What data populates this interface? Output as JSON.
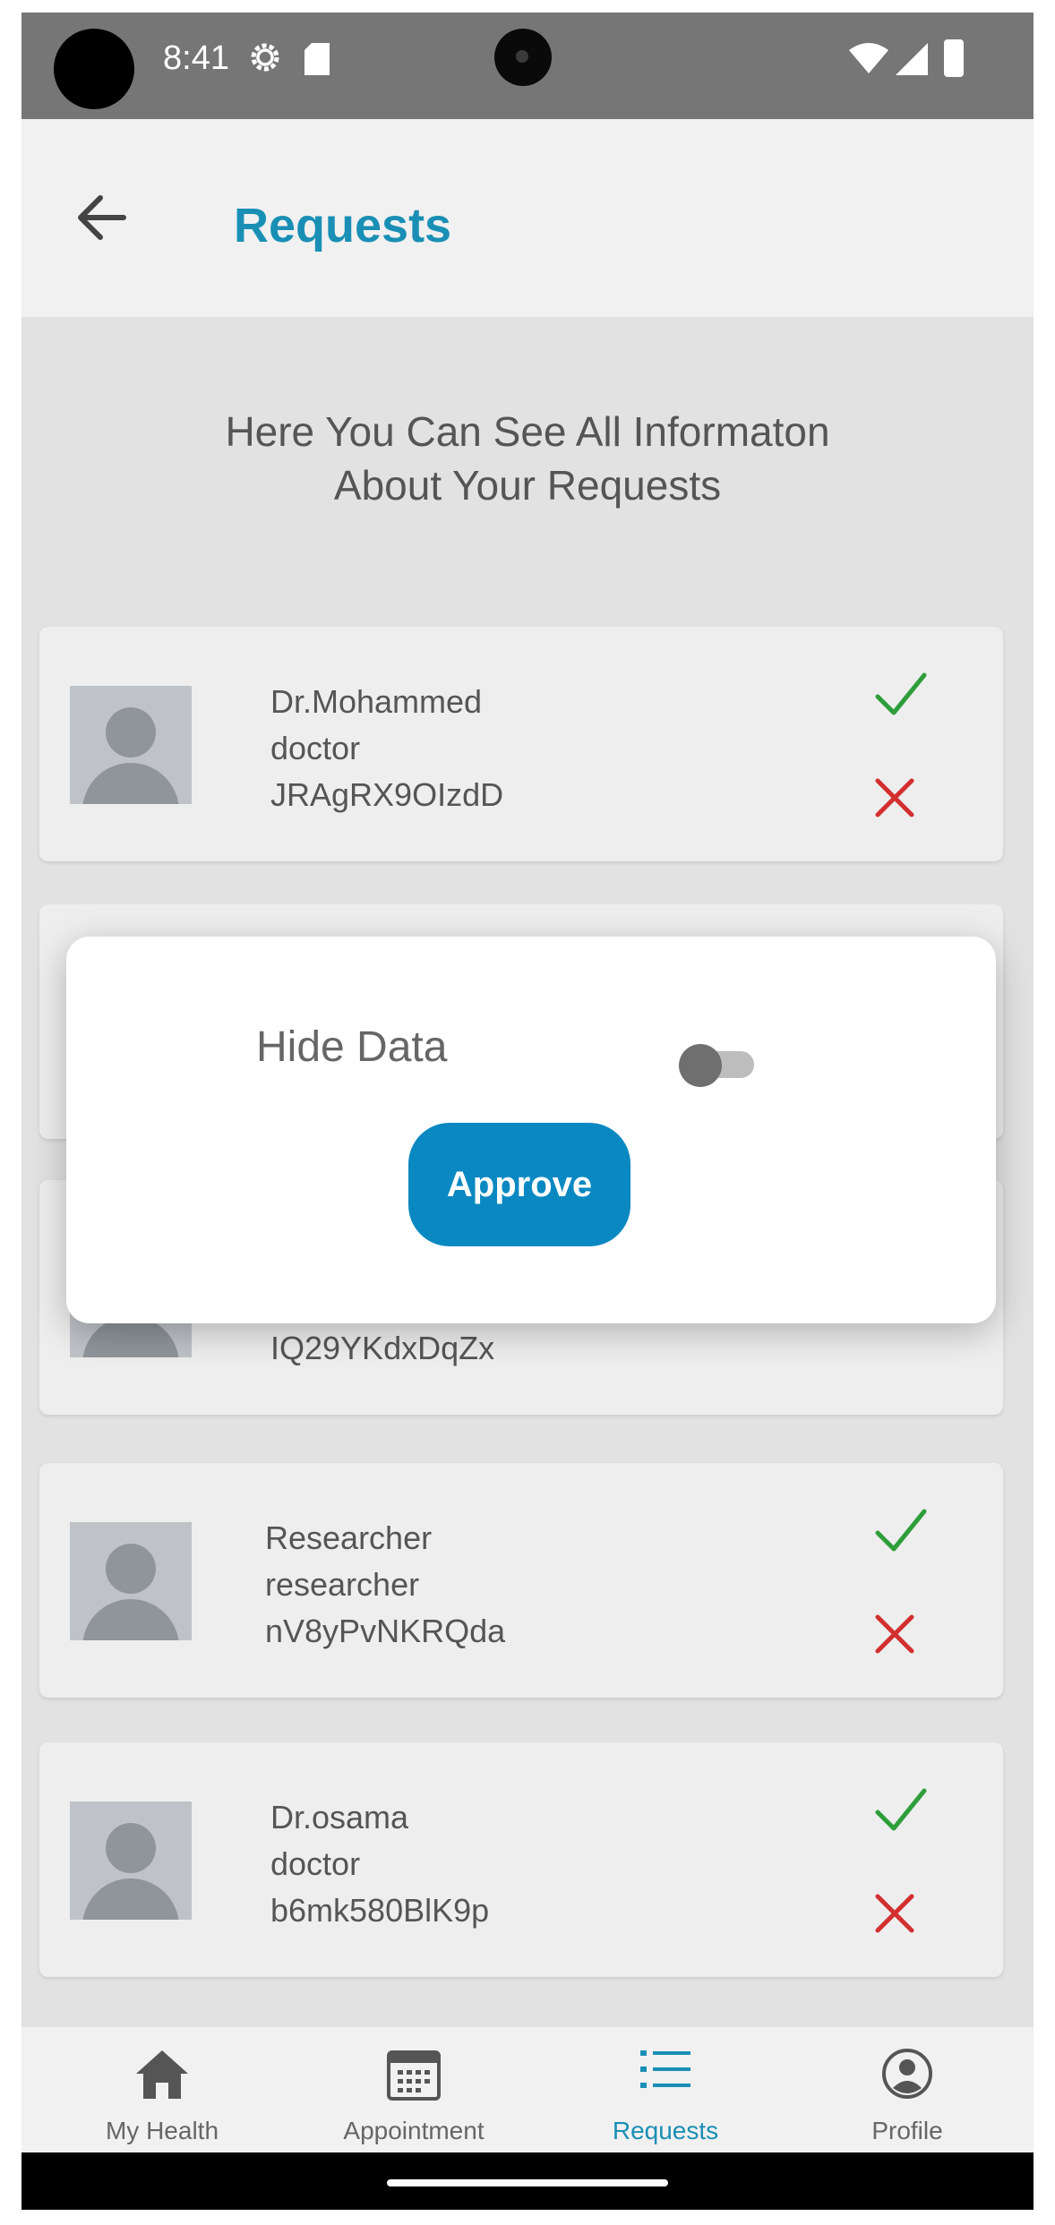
{
  "status_bar": {
    "time": "8:41"
  },
  "app_bar": {
    "title": "Requests"
  },
  "subtitle": {
    "line1": "Here You Can See All Informaton",
    "line2": "About Your Requests"
  },
  "requests": [
    {
      "name": "Dr.Mohammed",
      "role": "doctor",
      "id": "JRAgRX9OIzdD"
    },
    {
      "name": "",
      "role": "",
      "id": ""
    },
    {
      "name": "",
      "role": "",
      "id": "IQ29YKdxDqZx"
    },
    {
      "name": "Researcher",
      "role": "researcher",
      "id": "nV8yPvNKRQda"
    },
    {
      "name": "Dr.osama",
      "role": "doctor",
      "id": "b6mk580BlK9p"
    }
  ],
  "dialog": {
    "hide_label": "Hide Data",
    "hide_data_on": false,
    "approve_label": "Approve"
  },
  "bottom_nav": [
    {
      "label": "My Health",
      "icon": "home-icon"
    },
    {
      "label": "Appointment",
      "icon": "calendar-icon"
    },
    {
      "label": "Requests",
      "icon": "list-icon",
      "active": true
    },
    {
      "label": "Profile",
      "icon": "profile-icon"
    }
  ],
  "colors": {
    "accent": "#1a8fb5",
    "approve_button": "#0a88c2",
    "check": "#2e9e3a",
    "cross": "#d32f2f"
  }
}
